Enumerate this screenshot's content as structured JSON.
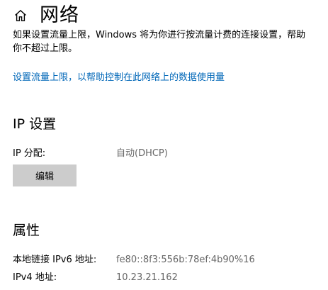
{
  "header": {
    "home_icon": "home-icon",
    "title": "网络"
  },
  "description": {
    "line1": "如果设置流量上限，Windows 将为你进行按流量计费的连接设置，帮助",
    "line2": "你不超过上限。"
  },
  "data_limit_link": "设置流量上限，以帮助控制在此网络上的数据使用量",
  "ip_settings": {
    "title": "IP 设置",
    "assignment_label": "IP 分配:",
    "assignment_value": "自动(DHCP)",
    "edit_label": "编辑"
  },
  "properties": {
    "title": "属性",
    "ipv6_label": "本地链接 IPv6 地址:",
    "ipv6_value": "fe80::8f3:556b:78ef:4b90%16",
    "ipv4_label": "IPv4 地址:",
    "ipv4_value": "10.23.21.162"
  },
  "colors": {
    "link": "#0067b8",
    "button_bg": "#cccccc",
    "secondary_text": "#666666"
  }
}
